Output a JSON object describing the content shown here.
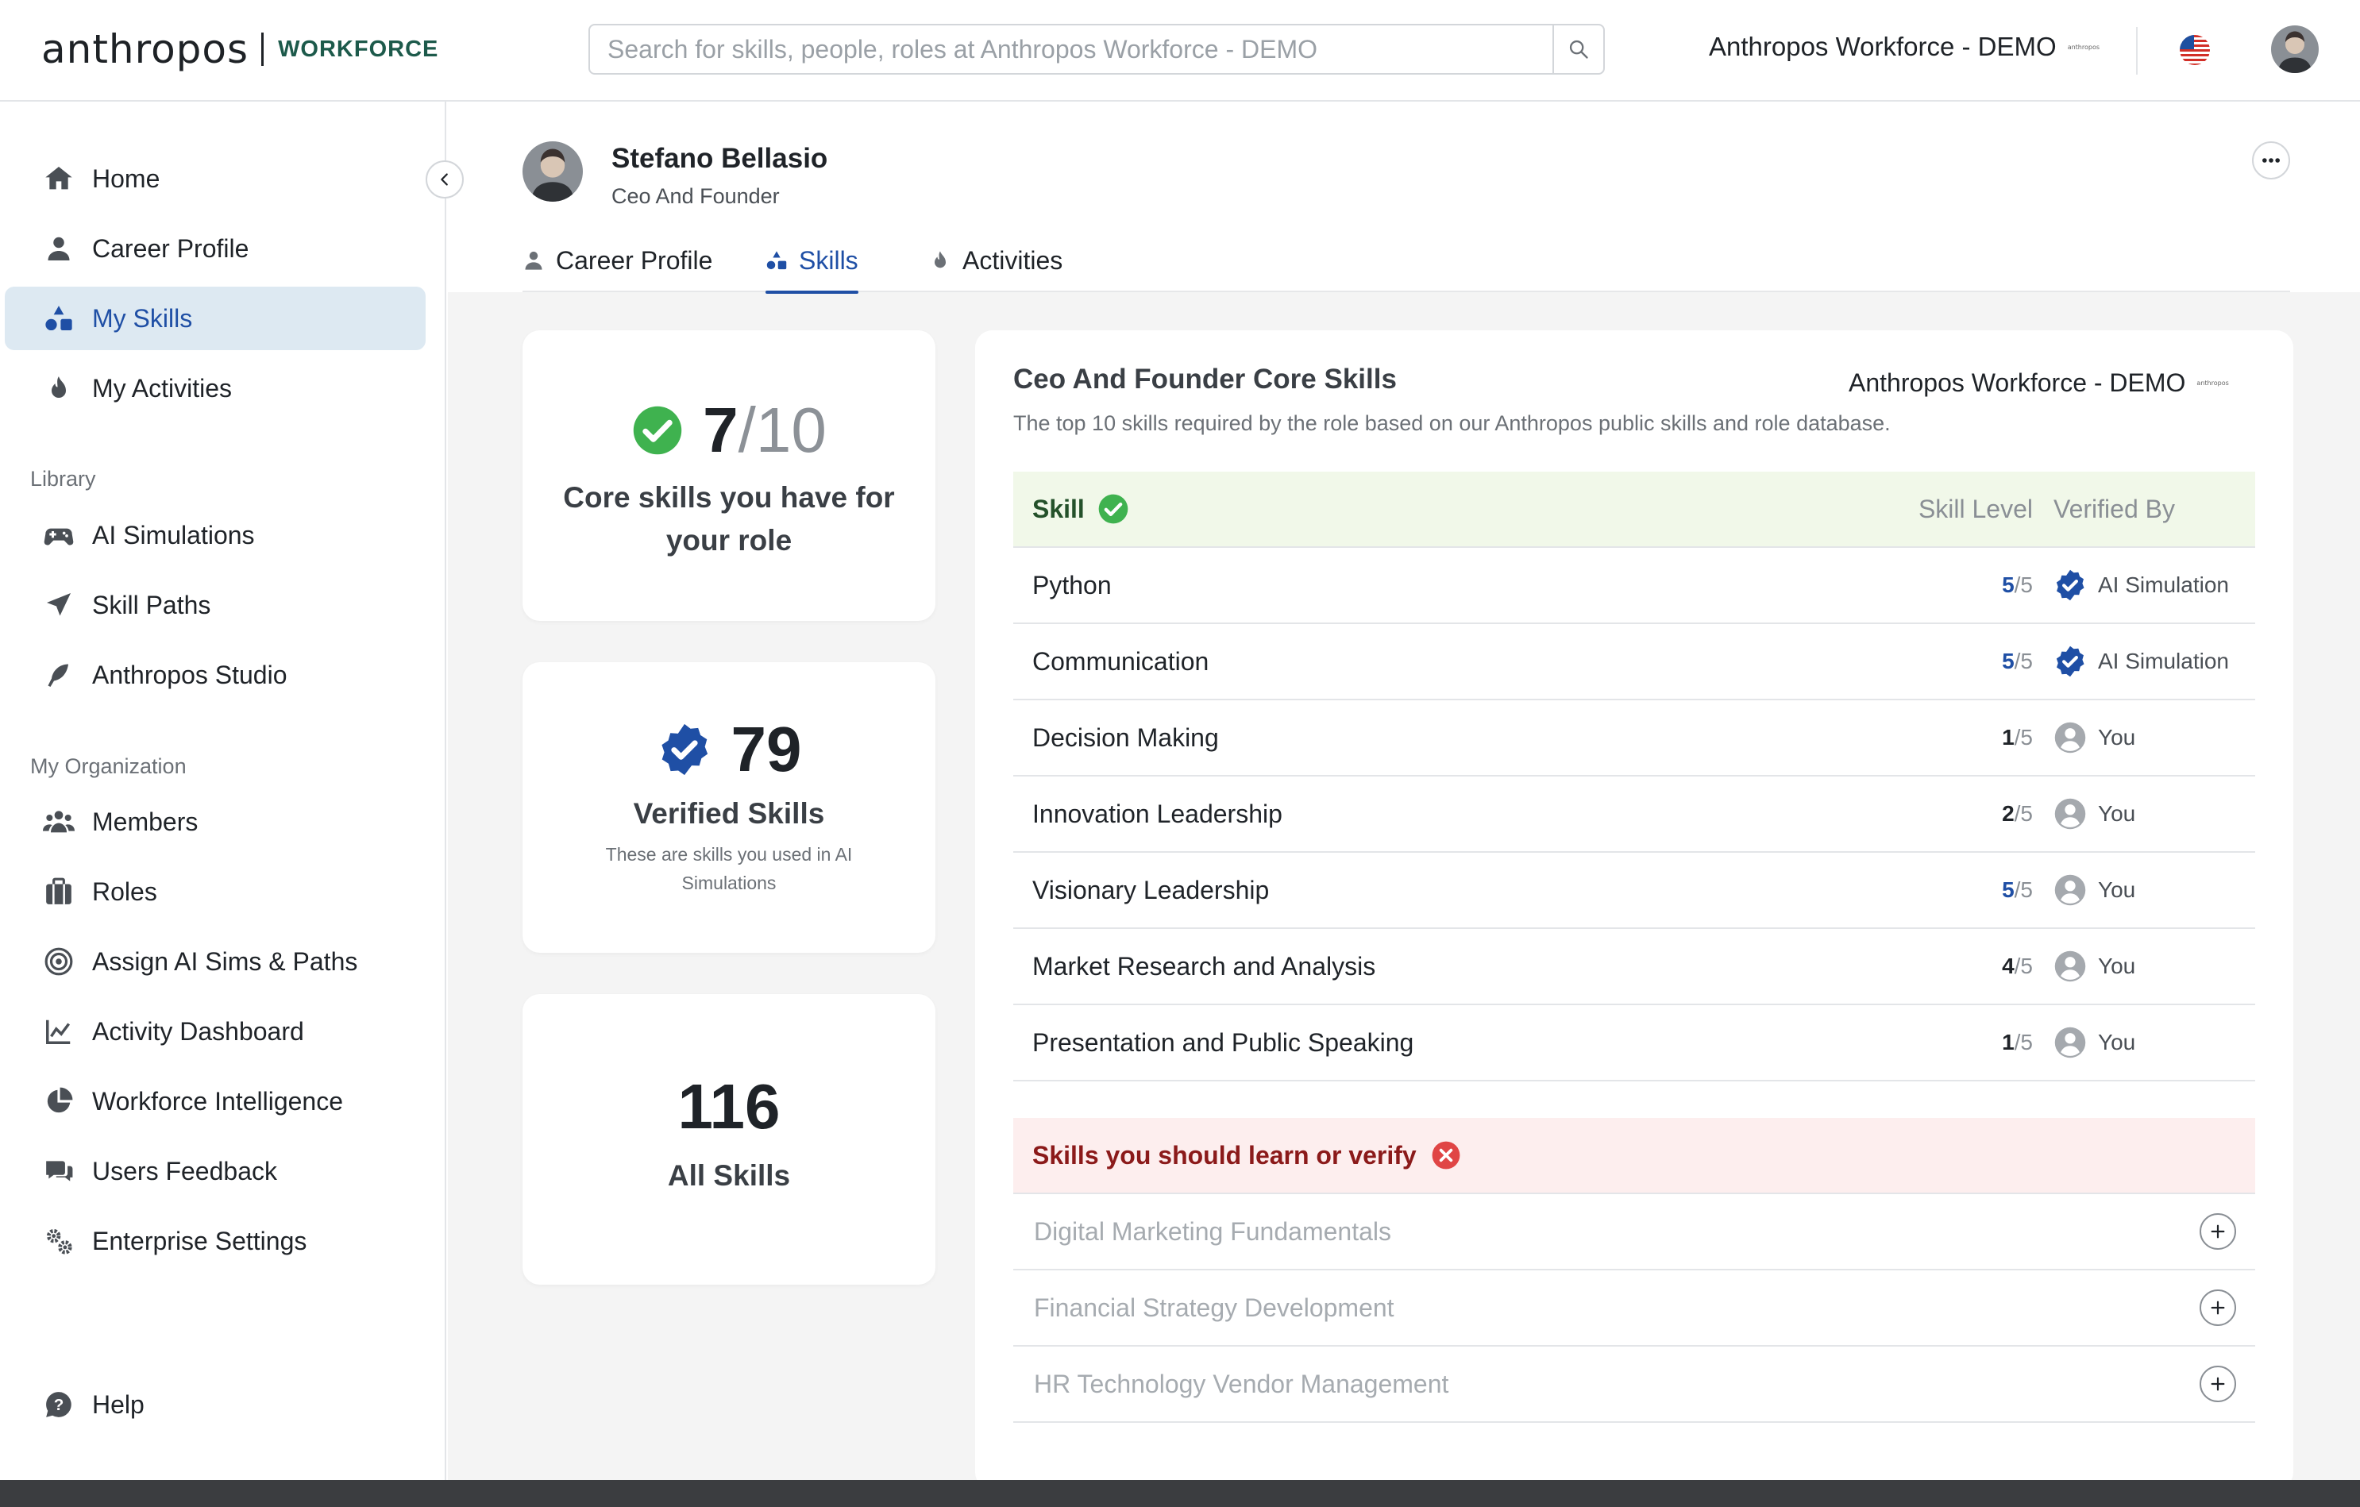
{
  "brand": {
    "wordmark": "anthropos",
    "product": "WORKFORCE"
  },
  "search": {
    "placeholder": "Search for skills, people, roles at Anthropos Workforce - DEMO"
  },
  "org": {
    "name": "Anthropos Workforce - DEMO",
    "logo_text": "anthropos"
  },
  "sidebar": {
    "main_items": [
      {
        "label": "Home",
        "icon": "home-icon"
      },
      {
        "label": "Career Profile",
        "icon": "person-icon"
      },
      {
        "label": "My Skills",
        "icon": "skills-icon",
        "active": true
      },
      {
        "label": "My Activities",
        "icon": "flame-icon"
      }
    ],
    "library_title": "Library",
    "library_items": [
      {
        "label": "AI Simulations",
        "icon": "gamepad-icon"
      },
      {
        "label": "Skill Paths",
        "icon": "send-icon"
      },
      {
        "label": "Anthropos Studio",
        "icon": "feather-icon"
      }
    ],
    "org_title": "My Organization",
    "org_items": [
      {
        "label": "Members",
        "icon": "members-icon"
      },
      {
        "label": "Roles",
        "icon": "briefcase-icon"
      },
      {
        "label": "Assign AI Sims & Paths",
        "icon": "target-icon"
      },
      {
        "label": "Activity Dashboard",
        "icon": "chart-line-icon"
      },
      {
        "label": "Workforce Intelligence",
        "icon": "pie-icon"
      },
      {
        "label": "Users Feedback",
        "icon": "chat-icon"
      },
      {
        "label": "Enterprise Settings",
        "icon": "gears-icon"
      }
    ],
    "help": "Help"
  },
  "profile": {
    "name": "Stefano Bellasio",
    "role": "Ceo And Founder"
  },
  "tabs": [
    {
      "label": "Career Profile",
      "icon": "person-icon"
    },
    {
      "label": "Skills",
      "icon": "skills-icon",
      "active": true
    },
    {
      "label": "Activities",
      "icon": "flame-icon"
    }
  ],
  "stats": {
    "core": {
      "have": "7",
      "total": "/10",
      "label_line1": "Core skills you have for",
      "label_line2": "your role"
    },
    "verified": {
      "count": "79",
      "label": "Verified Skills",
      "sub_line1": "These are skills you used in AI",
      "sub_line2": "Simulations"
    },
    "all": {
      "count": "116",
      "label": "All Skills"
    }
  },
  "core_skills": {
    "title": "Ceo And Founder Core Skills",
    "description": "The top 10 skills required by the role based on our Anthropos public skills and role database.",
    "headers": {
      "skill": "Skill",
      "level": "Skill Level",
      "verified_by": "Verified By"
    },
    "rows": [
      {
        "skill": "Python",
        "level": "5",
        "max": "/5",
        "verified_by": "AI Simulation",
        "verified": true
      },
      {
        "skill": "Communication",
        "level": "5",
        "max": "/5",
        "verified_by": "AI Simulation",
        "verified": true
      },
      {
        "skill": "Decision Making",
        "level": "1",
        "max": "/5",
        "verified_by": "You",
        "verified": false
      },
      {
        "skill": "Innovation Leadership",
        "level": "2",
        "max": "/5",
        "verified_by": "You",
        "verified": false
      },
      {
        "skill": "Visionary Leadership",
        "level": "5",
        "max": "/5",
        "verified_by": "You",
        "verified": false
      },
      {
        "skill": "Market Research and Analysis",
        "level": "4",
        "max": "/5",
        "verified_by": "You",
        "verified": false
      },
      {
        "skill": "Presentation and Public Speaking",
        "level": "1",
        "max": "/5",
        "verified_by": "You",
        "verified": false
      }
    ],
    "learn_title": "Skills you should learn or verify",
    "learn_rows": [
      "Digital Marketing Fundamentals",
      "Financial Strategy Development",
      "HR Technology Vendor Management"
    ]
  },
  "colors": {
    "accent": "#1f4fa5",
    "brand_green": "#1d5a4b",
    "success": "#3fb24f",
    "danger": "#e04545"
  }
}
